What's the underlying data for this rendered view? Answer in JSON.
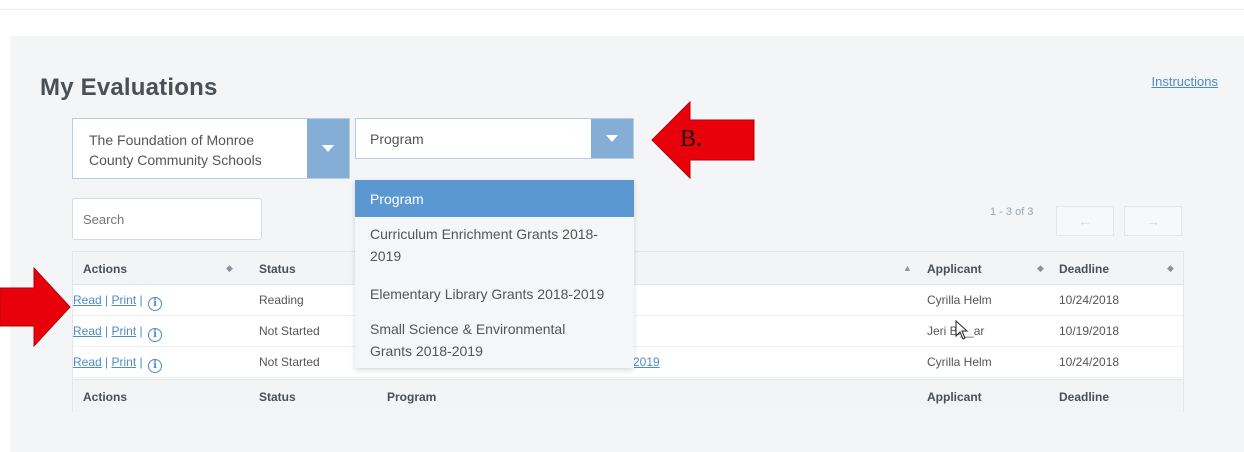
{
  "page": {
    "title": "My Evaluations",
    "instructions_link": "Instructions"
  },
  "filters": {
    "organization": "The Foundation of Monroe County Community Schools",
    "program": "Program",
    "search_placeholder": "Search"
  },
  "dropdown": {
    "options": [
      "Program",
      "Curriculum Enrichment Grants 2018-2019",
      "Elementary Library Grants 2018-2019",
      "Small Science & Environmental Grants 2018-2019"
    ],
    "option_lines": {
      "curriculum_1": "Curriculum Enrichment Grants 2018-",
      "curriculum_2": "2019",
      "small_science_1": "Small Science & Environmental",
      "small_science_2": "Grants 2018-2019"
    },
    "selected_index": 0
  },
  "pagination": {
    "summary": "1 - 3 of 3",
    "prev": "←",
    "next": "→"
  },
  "table": {
    "columns": {
      "actions": "Actions",
      "status": "Status",
      "program": "Program",
      "applicant": "Applicant",
      "deadline": "Deadline"
    },
    "action_links": {
      "read": "Read",
      "print": "Print",
      "separator": "|",
      "info": "i"
    },
    "rows": [
      {
        "status": "Reading",
        "program": "",
        "applicant": "Cyrilla Helm",
        "deadline": "10/24/2018"
      },
      {
        "status": "Not Started",
        "program": "",
        "applicant": "Jeri Bl__ar",
        "deadline": "10/19/2018"
      },
      {
        "status": "Not Started",
        "program": "2019",
        "applicant": "Cyrilla Helm",
        "deadline": "10/24/2018"
      }
    ]
  },
  "annotations": {
    "arrow_b_label": "B.",
    "arrow_color": "#e8000b"
  },
  "colors": {
    "accent": "#5b98d2",
    "caret_bg": "#85aed6",
    "link": "#4e8bc7"
  }
}
